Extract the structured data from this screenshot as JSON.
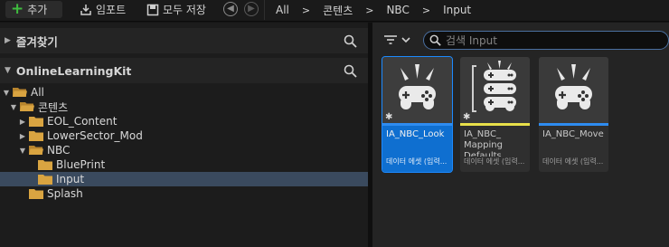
{
  "toolbar": {
    "add_label": "추가",
    "import_label": "임포트",
    "save_all_label": "모두 저장",
    "breadcrumbs": [
      "All",
      "콘텐츠",
      "NBC",
      "Input"
    ],
    "breadcrumb_separator": ">"
  },
  "sidebar": {
    "favorites_label": "즐겨찾기",
    "project_label": "OnlineLearningKit",
    "tree": [
      {
        "label": "All",
        "expanded": true
      },
      {
        "label": "콘텐츠",
        "expanded": true
      },
      {
        "label": "EOL_Content",
        "expanded": false
      },
      {
        "label": "LowerSector_Mod",
        "expanded": false
      },
      {
        "label": "NBC",
        "expanded": true
      },
      {
        "label": "BluePrint"
      },
      {
        "label": "Input",
        "selected": true
      },
      {
        "label": "Splash"
      }
    ]
  },
  "content": {
    "search_placeholder": "검색 Input",
    "assets": [
      {
        "name": "IA_NBC_Look",
        "type": "데이터 에셋 (입력...",
        "selected": true,
        "bar_color": "#2e8cf0",
        "icon": "gamepad-icon"
      },
      {
        "name": "IA_NBC_ Mapping Defaults",
        "type": "데이터 에셋 (입력...",
        "selected": false,
        "bar_color": "#e8e04a",
        "icon": "gamepad-stack-icon"
      },
      {
        "name": "IA_NBC_Move",
        "type": "데이터 에셋 (입력...",
        "selected": false,
        "bar_color": "#2e8cf0",
        "icon": "gamepad-icon"
      }
    ]
  },
  "colors": {
    "accent_blue": "#0f6fd0",
    "add_green": "#3fbd3f",
    "folder_orange": "#d9a441",
    "mapping_yellow": "#e8e04a"
  }
}
